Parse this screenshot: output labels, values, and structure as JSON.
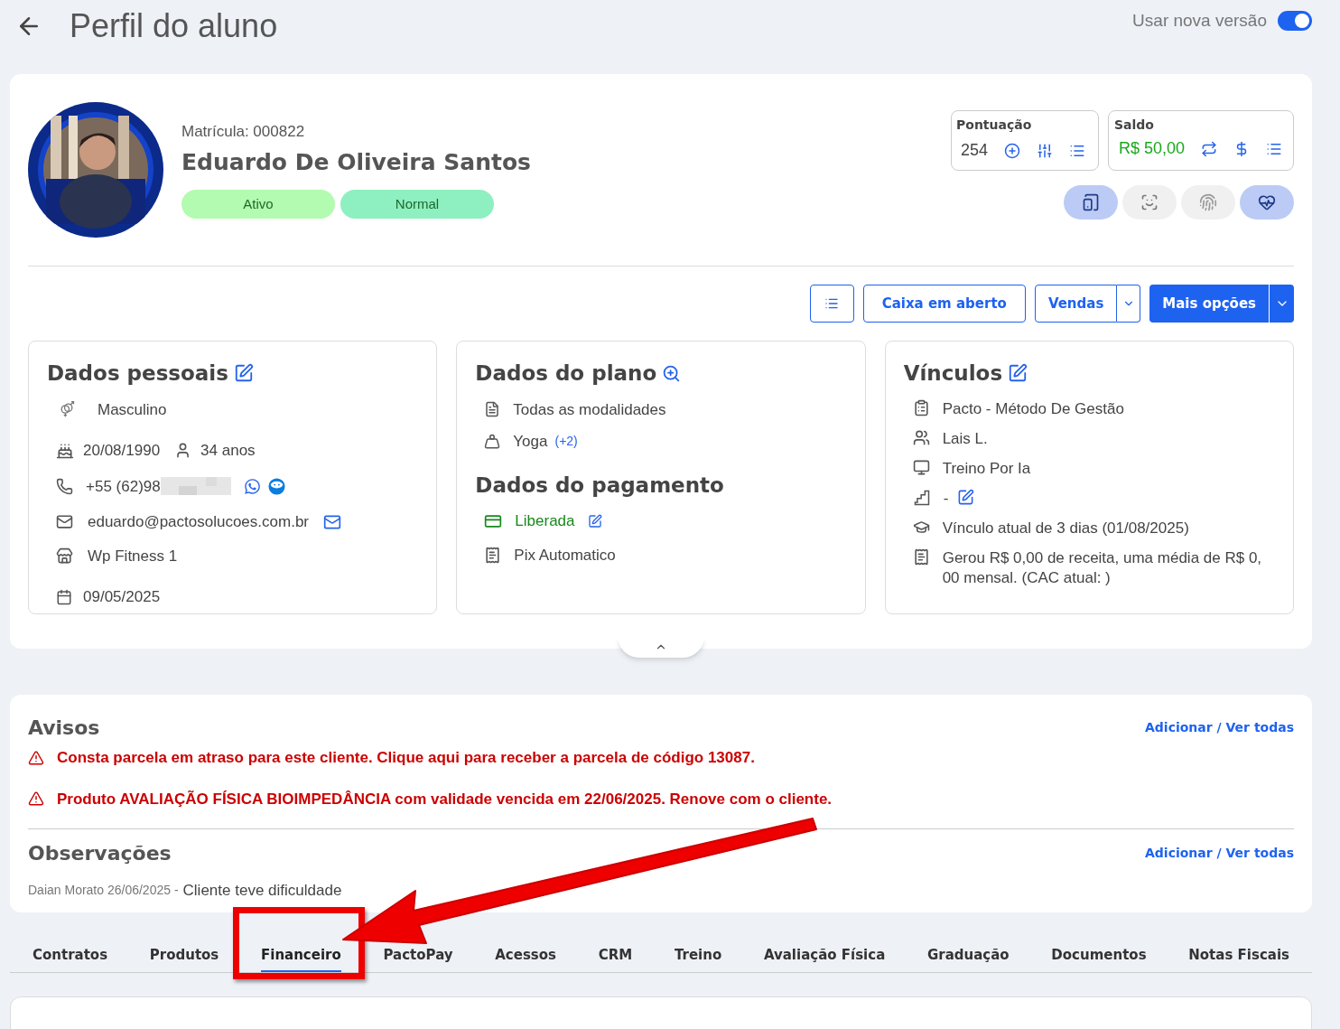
{
  "header": {
    "title": "Perfil do aluno",
    "toggle": {
      "label": "Usar nova versão",
      "on": true
    }
  },
  "profile": {
    "enrollment": "Matrícula: 000822",
    "name": "Eduardo De Oliveira Santos",
    "badges": [
      {
        "label": "Ativo",
        "color": "#b3fbb0"
      },
      {
        "label": "Normal",
        "color": "#8eefc0"
      }
    ]
  },
  "score": {
    "title": "Pontuação",
    "value": "254"
  },
  "balance": {
    "title": "Saldo",
    "value": "R$ 50,00"
  },
  "quick_actions": [
    {
      "kind": "app",
      "active": true
    },
    {
      "kind": "face",
      "active": false
    },
    {
      "kind": "fingerprint",
      "active": false
    },
    {
      "kind": "health",
      "active": true
    }
  ],
  "actions": [
    {
      "kind": "icon"
    },
    {
      "kind": "outline",
      "label": "Caixa em aberto"
    },
    {
      "kind": "split",
      "label": "Vendas"
    },
    {
      "kind": "primary_split",
      "label": "Mais opções"
    }
  ],
  "personal": {
    "title": "Dados pessoais",
    "gender": "Masculino",
    "birth": "20/08/1990",
    "age": "34 anos",
    "phone": "+55 (62)98",
    "email": "eduardo@pactosolucoes.com.br",
    "unit": "Wp Fitness 1",
    "date": "09/05/2025"
  },
  "plan": {
    "title": "Dados do plano",
    "items": [
      {
        "kind": "doc",
        "text": "Todas as modalidades"
      },
      {
        "kind": "weight",
        "text": "Yoga",
        "extra": "(+2)"
      }
    ]
  },
  "payment": {
    "title": "Dados do pagamento",
    "status": "Liberada",
    "method": "Pix Automatico"
  },
  "links": {
    "title": "Vínculos",
    "items": [
      {
        "kind": "clipboard",
        "text": "Pacto - Método De Gestão"
      },
      {
        "kind": "group",
        "text": "Lais L."
      },
      {
        "kind": "monitor",
        "text": "Treino Por Ia"
      },
      {
        "kind": "stairs",
        "text": "-",
        "editable": true
      },
      {
        "kind": "cap",
        "text": "Vínculo atual de 3 dias (01/08/2025)"
      },
      {
        "kind": "receipt",
        "text": "Gerou R$ 0,00 de receita, uma média de R$ 0, 00 mensal. (CAC atual: )"
      }
    ]
  },
  "notices": {
    "title": "Avisos",
    "link": "Adicionar / Ver todas",
    "items": [
      "Consta parcela em atraso para este cliente. Clique aqui para receber a parcela de código 13087.",
      "Produto AVALIAÇÃO FÍSICA BIOIMPEDÂNCIA com validade vencida em 22/06/2025. Renove com o cliente."
    ]
  },
  "observations": {
    "title": "Observações",
    "link": "Adicionar / Ver todas",
    "items": [
      {
        "meta": "Daian Morato 26/06/2025 -",
        "text": "Cliente teve dificuldade"
      }
    ]
  },
  "tabs": [
    {
      "label": "Contratos",
      "selected": false
    },
    {
      "label": "Produtos",
      "selected": false
    },
    {
      "label": "Financeiro",
      "selected": true
    },
    {
      "label": "PactoPay",
      "selected": false
    },
    {
      "label": "Acessos",
      "selected": false
    },
    {
      "label": "CRM",
      "selected": false
    },
    {
      "label": "Treino",
      "selected": false
    },
    {
      "label": "Avaliação Física",
      "selected": false
    },
    {
      "label": "Graduação",
      "selected": false
    },
    {
      "label": "Documentos",
      "selected": false
    },
    {
      "label": "Notas Fiscais",
      "selected": false
    }
  ]
}
